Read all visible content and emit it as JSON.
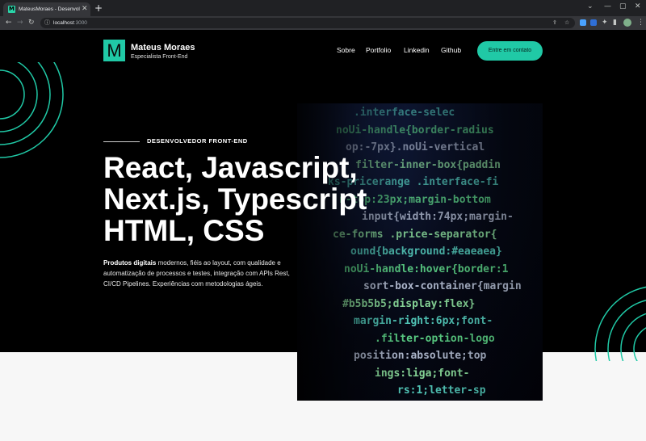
{
  "browser": {
    "tab_title": "MateusMoraes - Desenvolvedor",
    "tab_close": "✕",
    "new_tab": "+",
    "url_host": "localhost",
    "url_port": ":3000",
    "window_controls": [
      "⌄",
      "—",
      "▢",
      "✕"
    ]
  },
  "header": {
    "logo_letter": "M",
    "brand_name": "Mateus Moraes",
    "brand_subtitle": "Especialista Front-End",
    "nav": [
      "Sobre",
      "Portfolio",
      "Linkedin",
      "Github"
    ],
    "cta": "Entre em contato"
  },
  "hero": {
    "eyebrow": "DESENVOLVEDOR FRONT-END",
    "title_lines": [
      "React, Javascript,",
      "Next.js, Typescript",
      "HTML, CSS"
    ],
    "description_bold": "Produtos digitais",
    "description_rest": " modernos, fiéis ao layout, com qualidade e automatização de processos e testes, integração com APIs Rest, CI/CD Pipelines. Experiências com metodologias ágeis."
  },
  "code_image": {
    "lines": [
      ".interface-selec",
      "noUi-handle{border-radius",
      "op:-7px}.noUi-vertical",
      "filter-inner-box{paddin",
      "ks-pricerange .interface-fi",
      "n-top:23px;margin-bottom",
      "input{width:74px;margin-",
      "ce-forms .price-separator{",
      "ound{background:#eaeaea}",
      "noUi-handle:hover{border:1",
      "sort-box-container{margin",
      "#b5b5b5;display:flex}",
      "margin-right:6px;font-",
      ".filter-option-logo",
      "position:absolute;top",
      "ings:liga;font-",
      "rs:1;letter-sp"
    ],
    "colors": {
      "selector": "#56d0c0",
      "property": "#5fd98a",
      "value": "#8fe3a0",
      "plain": "#b8c2d8"
    }
  },
  "colors": {
    "accent": "#20c9a6",
    "background": "#000000",
    "light_band": "#f7f7f7"
  }
}
